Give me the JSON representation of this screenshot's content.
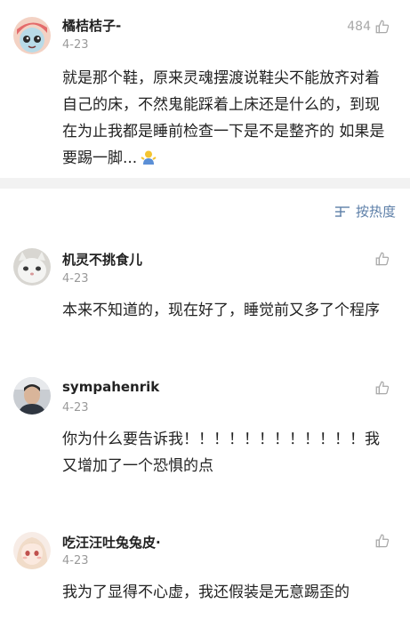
{
  "comments": [
    {
      "name": "橘桔桔子-",
      "date": "4-23",
      "likes": "484",
      "text": "就是那个鞋，原来灵魂摆渡说鞋尖不能放齐对着自己的床，不然鬼能踩着上床还是什么的，到现在为止我都是睡前检查一下是不是整齐的 如果是要踢一脚..."
    },
    {
      "name": "机灵不挑食儿",
      "date": "4-23",
      "likes": "",
      "text": "本来不知道的，现在好了，睡觉前又多了个程序"
    },
    {
      "name": "sympahenrik",
      "date": "4-23",
      "likes": "",
      "text": "你为什么要告诉我！！！！！！！！！！！！我又增加了一个恐惧的点"
    },
    {
      "name": "吃汪汪吐兔兔皮·",
      "date": "4-23",
      "likes": "",
      "text": "我为了显得不心虚，我还假装是无意踢歪的"
    }
  ],
  "sort": {
    "label": "按热度"
  },
  "icons": {
    "like": "thumbs-up-icon",
    "sort": "sort-icon",
    "emoji": "shrug-emoji-icon"
  },
  "colors": {
    "link": "#5d7fa8",
    "muted": "#9a9a9a",
    "divider": "#f2f2f2"
  }
}
